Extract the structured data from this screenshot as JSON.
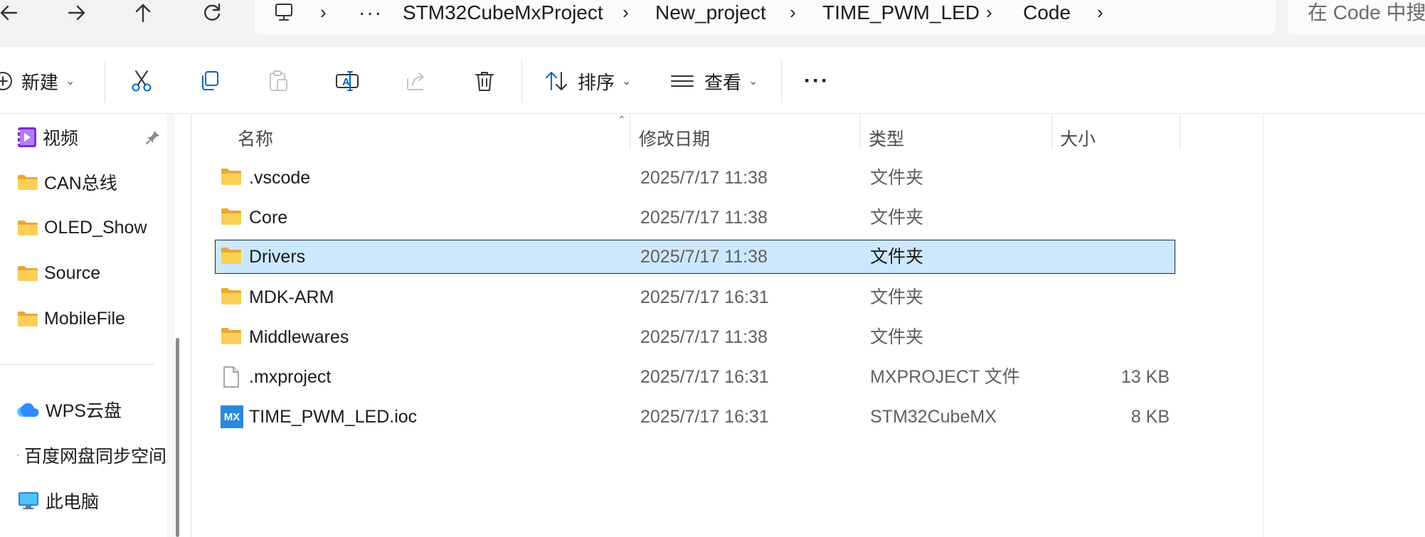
{
  "nav": {
    "back_icon": "back-arrow-icon",
    "forward_icon": "forward-arrow-icon",
    "up_icon": "up-arrow-icon",
    "refresh_icon": "refresh-icon"
  },
  "breadcrumb": {
    "more": "···",
    "items": [
      "STM32CubeMxProject",
      "New_project",
      "TIME_PWM_LED",
      "Code"
    ]
  },
  "search": {
    "placeholder": "在 Code 中搜"
  },
  "toolbar": {
    "new_label": "新建",
    "sort_label": "排序",
    "view_label": "查看",
    "more_label": "···"
  },
  "sidebar": {
    "items": [
      {
        "label": "视频",
        "icon": "video-folder-icon",
        "pinned": true
      },
      {
        "label": "CAN总线",
        "icon": "folder-icon"
      },
      {
        "label": "OLED_Show",
        "icon": "folder-icon"
      },
      {
        "label": "Source",
        "icon": "folder-icon"
      },
      {
        "label": "MobileFile",
        "icon": "folder-icon"
      },
      {
        "label": "WPS云盘",
        "icon": "cloud-icon"
      },
      {
        "label": "百度网盘同步空间",
        "icon": "baidu-sync-icon"
      },
      {
        "label": "此电脑",
        "icon": "computer-icon"
      }
    ]
  },
  "columns": {
    "name": "名称",
    "date": "修改日期",
    "type": "类型",
    "size": "大小"
  },
  "files": [
    {
      "name": ".vscode",
      "date": "2025/7/17 11:38",
      "type": "文件夹",
      "size": "",
      "icon": "folder-icon"
    },
    {
      "name": "Core",
      "date": "2025/7/17 11:38",
      "type": "文件夹",
      "size": "",
      "icon": "folder-icon"
    },
    {
      "name": "Drivers",
      "date": "2025/7/17 11:38",
      "type": "文件夹",
      "size": "",
      "icon": "folder-icon",
      "selected": true
    },
    {
      "name": "MDK-ARM",
      "date": "2025/7/17 16:31",
      "type": "文件夹",
      "size": "",
      "icon": "folder-icon"
    },
    {
      "name": "Middlewares",
      "date": "2025/7/17 11:38",
      "type": "文件夹",
      "size": "",
      "icon": "folder-icon"
    },
    {
      "name": ".mxproject",
      "date": "2025/7/17 16:31",
      "type": "MXPROJECT 文件",
      "size": "13 KB",
      "icon": "generic-file-icon"
    },
    {
      "name": "TIME_PWM_LED.ioc",
      "date": "2025/7/17 16:31",
      "type": "STM32CubeMX",
      "size": "8 KB",
      "icon": "stm32cubemx-file-icon",
      "badge": "MX"
    }
  ],
  "colors": {
    "selection_bg": "#cce8ff",
    "folder_yellow": "#f8c84a",
    "accent": "#0067c0"
  }
}
